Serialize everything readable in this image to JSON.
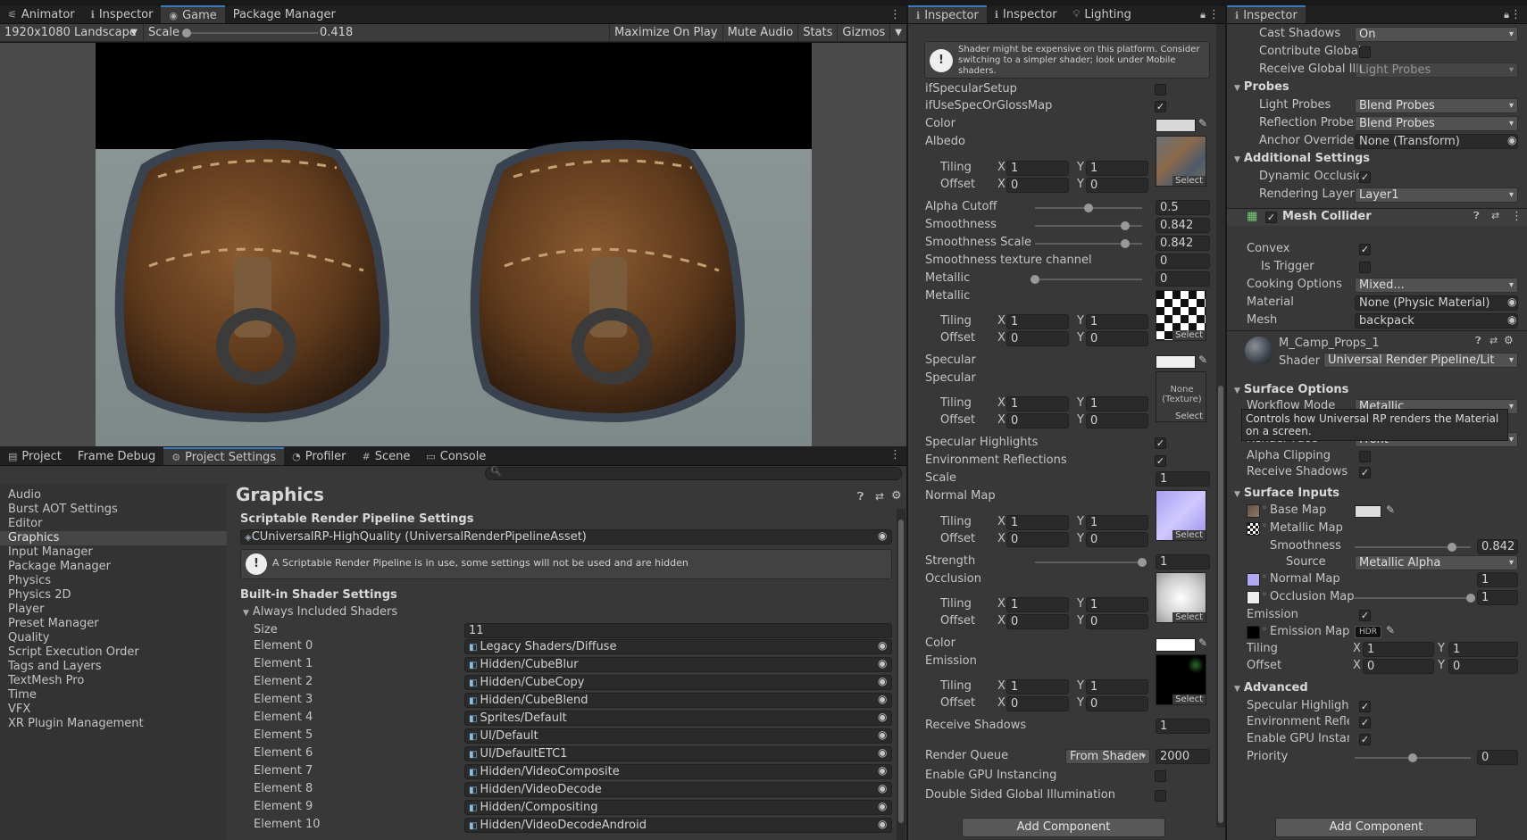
{
  "game_window": {
    "tabs": [
      {
        "label": "Animator",
        "icon": "animator-icon"
      },
      {
        "label": "Inspector",
        "icon": "inspector-icon"
      },
      {
        "label": "Game",
        "icon": "game-icon"
      },
      {
        "label": "Package Manager",
        "icon": ""
      }
    ],
    "resolution": "1920x1080 Landscape",
    "scale_label": "Scale",
    "scale_value": "0.418",
    "buttons": [
      "Maximize On Play",
      "Mute Audio",
      "Stats",
      "Gizmos"
    ]
  },
  "project_window": {
    "tabs": [
      {
        "label": "Project"
      },
      {
        "label": "Frame Debug"
      },
      {
        "label": "Project Settings"
      },
      {
        "label": "Profiler"
      },
      {
        "label": "Scene"
      },
      {
        "label": "Console"
      }
    ],
    "sidebar": [
      "Audio",
      "Burst AOT Settings",
      "Editor",
      "Graphics",
      "Input Manager",
      "Package Manager",
      "Physics",
      "Physics 2D",
      "Player",
      "Preset Manager",
      "Quality",
      "Script Execution Order",
      "Tags and Layers",
      "TextMesh Pro",
      "Time",
      "VFX",
      "XR Plugin Management"
    ],
    "selected": "Graphics",
    "title": "Graphics",
    "srp_header": "Scriptable Render Pipeline Settings",
    "srp_asset": "CUniversalRP-HighQuality (UniversalRenderPipelineAsset)",
    "srp_warning": "A Scriptable Render Pipeline is in use, some settings will not be used and are hidden",
    "builtin_header": "Built-in Shader Settings",
    "always_included": "Always Included Shaders",
    "size_label": "Size",
    "size_value": "11",
    "elements": [
      {
        "label": "Element 0",
        "value": "Legacy Shaders/Diffuse"
      },
      {
        "label": "Element 1",
        "value": "Hidden/CubeBlur"
      },
      {
        "label": "Element 2",
        "value": "Hidden/CubeCopy"
      },
      {
        "label": "Element 3",
        "value": "Hidden/CubeBlend"
      },
      {
        "label": "Element 4",
        "value": "Sprites/Default"
      },
      {
        "label": "Element 5",
        "value": "UI/Default"
      },
      {
        "label": "Element 6",
        "value": "UI/DefaultETC1"
      },
      {
        "label": "Element 7",
        "value": "Hidden/VideoComposite"
      },
      {
        "label": "Element 8",
        "value": "Hidden/VideoDecode"
      },
      {
        "label": "Element 9",
        "value": "Hidden/Compositing"
      },
      {
        "label": "Element 10",
        "value": "Hidden/VideoDecodeAndroid"
      }
    ]
  },
  "inspector_mid": {
    "tabs": [
      {
        "label": "Inspector"
      },
      {
        "label": "Inspector"
      },
      {
        "label": "Lighting"
      }
    ],
    "warning": "Shader might be expensive on this platform. Consider switching to a simpler shader; look under Mobile shaders.",
    "if_specular_setup": "ifSpecularSetup",
    "if_use_spec": "ifUseSpecOrGlossMap",
    "color": "Color",
    "albedo": "Albedo",
    "tiling": "Tiling",
    "offset": "Offset",
    "x": "X",
    "y": "Y",
    "one": "1",
    "zero": "0",
    "select": "Select",
    "alpha_cutoff": "Alpha Cutoff",
    "alpha_cutoff_value": "0.5",
    "smoothness": "Smoothness",
    "smoothness_value": "0.842",
    "smoothness_scale": "Smoothness Scale",
    "smoothness_scale_value": "0.842",
    "smoothness_channel": "Smoothness texture channel",
    "smoothness_channel_value": "0",
    "metallic": "Metallic",
    "metallic_value": "0",
    "metallic_map": "Metallic",
    "specular": "Specular",
    "specular_map": "Specular",
    "none_texture": "None (Texture)",
    "specular_highlights": "Specular Highlights",
    "environment_reflections": "Environment Reflections",
    "scale": "Scale",
    "scale_value": "1",
    "normal_map": "Normal Map",
    "strength": "Strength",
    "strength_value": "1",
    "occlusion": "Occlusion",
    "color2": "Color",
    "emission": "Emission",
    "receive_shadows": "Receive Shadows",
    "receive_shadows_value": "1",
    "render_queue": "Render Queue",
    "render_queue_mode": "From Shader",
    "render_queue_value": "2000",
    "gpu_instancing": "Enable GPU Instancing",
    "double_sided": "Double Sided Global Illumination",
    "add_component": "Add Component",
    "slider_levels": {
      "alpha_cutoff": 0.5,
      "smoothness": 0.842,
      "smoothness_scale": 0.842,
      "metallic": 0,
      "strength": 1
    }
  },
  "inspector_right": {
    "tab": "Inspector",
    "cast_shadows": "Cast Shadows",
    "cast_shadows_value": "On",
    "contribute_gi": "Contribute Global",
    "receive_gi": "Receive Global Illu",
    "receive_gi_value": "Light Probes",
    "probes": "Probes",
    "light_probes": "Light Probes",
    "light_probes_value": "Blend Probes",
    "reflection_probes": "Reflection Probes",
    "reflection_probes_value": "Blend Probes",
    "anchor_override": "Anchor Override",
    "anchor_override_value": "None (Transform)",
    "additional_settings": "Additional Settings",
    "dynamic_occlusion": "Dynamic Occlusio",
    "rendering_layer": "Rendering Layer M",
    "rendering_layer_value": "Layer1",
    "mesh_collider": "Mesh Collider",
    "convex": "Convex",
    "is_trigger": "Is Trigger",
    "cooking_options": "Cooking Options",
    "cooking_options_value": "Mixed...",
    "material": "Material",
    "material_value": "None (Physic Material)",
    "mesh": "Mesh",
    "mesh_value": "backpack",
    "material_name": "M_Camp_Props_1",
    "shader_label": "Shader",
    "shader_value": "Universal Render Pipeline/Lit",
    "surface_options": "Surface Options",
    "workflow_mode": "Workflow Mode",
    "workflow_mode_value": "Metallic",
    "tooltip": "Controls how Universal RP renders the Material on a screen.",
    "render_face": "Render Face",
    "render_face_value": "Front",
    "alpha_clipping": "Alpha Clipping",
    "receive_shadows": "Receive Shadows",
    "surface_inputs": "Surface Inputs",
    "base_map": "Base Map",
    "metallic_map": "Metallic Map",
    "smoothness": "Smoothness",
    "smoothness_value": "0.842",
    "source": "Source",
    "source_value": "Metallic Alpha",
    "normal_map": "Normal Map",
    "normal_value": "1",
    "occlusion_map": "Occlusion Map",
    "occlusion_value": "1",
    "emission": "Emission",
    "emission_map": "Emission Map",
    "hdr": "HDR",
    "tiling": "Tiling",
    "offset": "Offset",
    "x": "X",
    "y": "Y",
    "one": "1",
    "zero": "0",
    "advanced": "Advanced",
    "specular_highlights": "Specular Highlights",
    "environment_reflections": "Environment Reflec",
    "gpu_instancing": "Enable GPU Instanc",
    "priority": "Priority",
    "priority_value": "0",
    "add_component": "Add Component",
    "slider_levels": {
      "smoothness": 0.842,
      "occlusion": 1
    }
  },
  "colors": {
    "accent": "#3a79bb",
    "panel": "#383838",
    "field": "#2a2a2a"
  }
}
